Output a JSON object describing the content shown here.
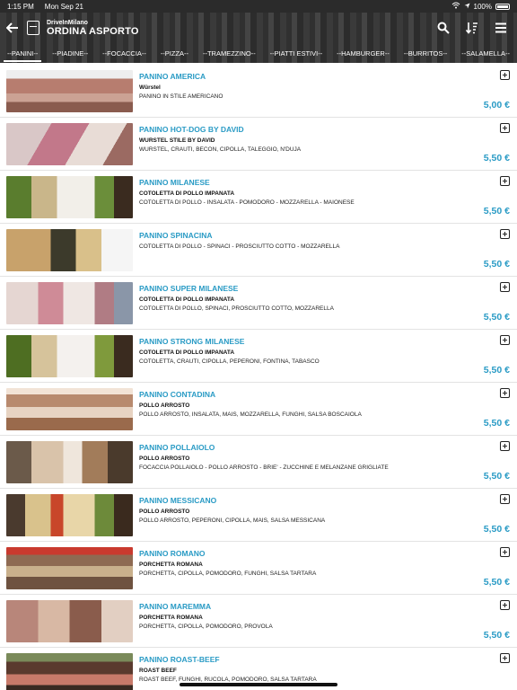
{
  "status_bar": {
    "time": "1:15 PM",
    "date": "Mon Sep 21",
    "battery": "100%"
  },
  "header": {
    "app_name": "DriveInMilano",
    "title": "ORDINA ASPORTO"
  },
  "tabs": [
    "--PANINI--",
    "--PIADINE--",
    "--FOCACCIA--",
    "--PIZZA--",
    "--TRAMEZZINO--",
    "--PIATTI ESTIVI--",
    "--HAMBURGER--",
    "--BURRITOS--",
    "--SALAMELLA--"
  ],
  "active_tab": 0,
  "items": [
    {
      "name": "PANINO AMERICA",
      "subtitle": "Würstel",
      "description": "PANINO IN STILE AMERICANO",
      "price": "5,00 €"
    },
    {
      "name": "PANINO HOT-DOG BY DAVID",
      "subtitle": "WURSTEL STILE BY DAVID",
      "description": "WURSTEL, CRAUTI, BECON, CIPOLLA, TALEGGIO, N'DUJA",
      "price": "5,50 €"
    },
    {
      "name": "PANINO MILANESE",
      "subtitle": "COTOLETTA DI POLLO IMPANATA",
      "description": "COTOLETTA DI POLLO - INSALATA - POMODORO - MOZZARELLA - MAIONESE",
      "price": "5,50 €"
    },
    {
      "name": "PANINO SPINACINA",
      "subtitle": "",
      "description": "COTOLETTA DI POLLO - SPINACI - PROSCIUTTO COTTO - MOZZARELLA",
      "price": "5,50 €"
    },
    {
      "name": "PANINO SUPER MILANESE",
      "subtitle": "COTOLETTA DI POLLO IMPANATA",
      "description": "COTOLETTA DI POLLO, SPINACI, PROSCIUTTO COTTO, MOZZARELLA",
      "price": "5,50 €"
    },
    {
      "name": "PANINO STRONG MILANESE",
      "subtitle": "COTOLETTA DI POLLO IMPANATA",
      "description": "COTOLETTA, CRAUTI, CIPOLLA, PEPERONI, FONTINA, TABASCO",
      "price": "5,50 €"
    },
    {
      "name": "PANINO CONTADINA",
      "subtitle": "POLLO ARROSTO",
      "description": "POLLO ARROSTO, INSALATA, MAIS, MOZZARELLA, FUNGHI, SALSA BOSCAIOLA",
      "price": "5,50 €"
    },
    {
      "name": "PANINO POLLAIOLO",
      "subtitle": "POLLO ARROSTO",
      "description": "FOCACCIA POLLAIOLO - POLLO ARROSTO - BRIE' - ZUCCHINE E MELANZANE GRIGLIATE",
      "price": "5,50 €"
    },
    {
      "name": "PANINO MESSICANO",
      "subtitle": "POLLO ARROSTO",
      "description": "POLLO ARROSTO, PEPERONI, CIPOLLA, MAIS, SALSA MESSICANA",
      "price": "5,50 €"
    },
    {
      "name": "PANINO ROMANO",
      "subtitle": "PORCHETTA ROMANA",
      "description": "PORCHETTA, CIPOLLA, POMODORO, FUNGHI, SALSA TARTARA",
      "price": "5,50 €"
    },
    {
      "name": "PANINO MAREMMA",
      "subtitle": "PORCHETTA ROMANA",
      "description": "PORCHETTA, CIPOLLA, POMODORO, PROVOLA",
      "price": "5,50 €"
    },
    {
      "name": "PANINO ROAST-BEEF",
      "subtitle": "ROAST BEEF",
      "description": "ROAST BEEF, FUNGHI, RUCOLA, POMODORO, SALSA TARTARA",
      "price": ""
    }
  ]
}
